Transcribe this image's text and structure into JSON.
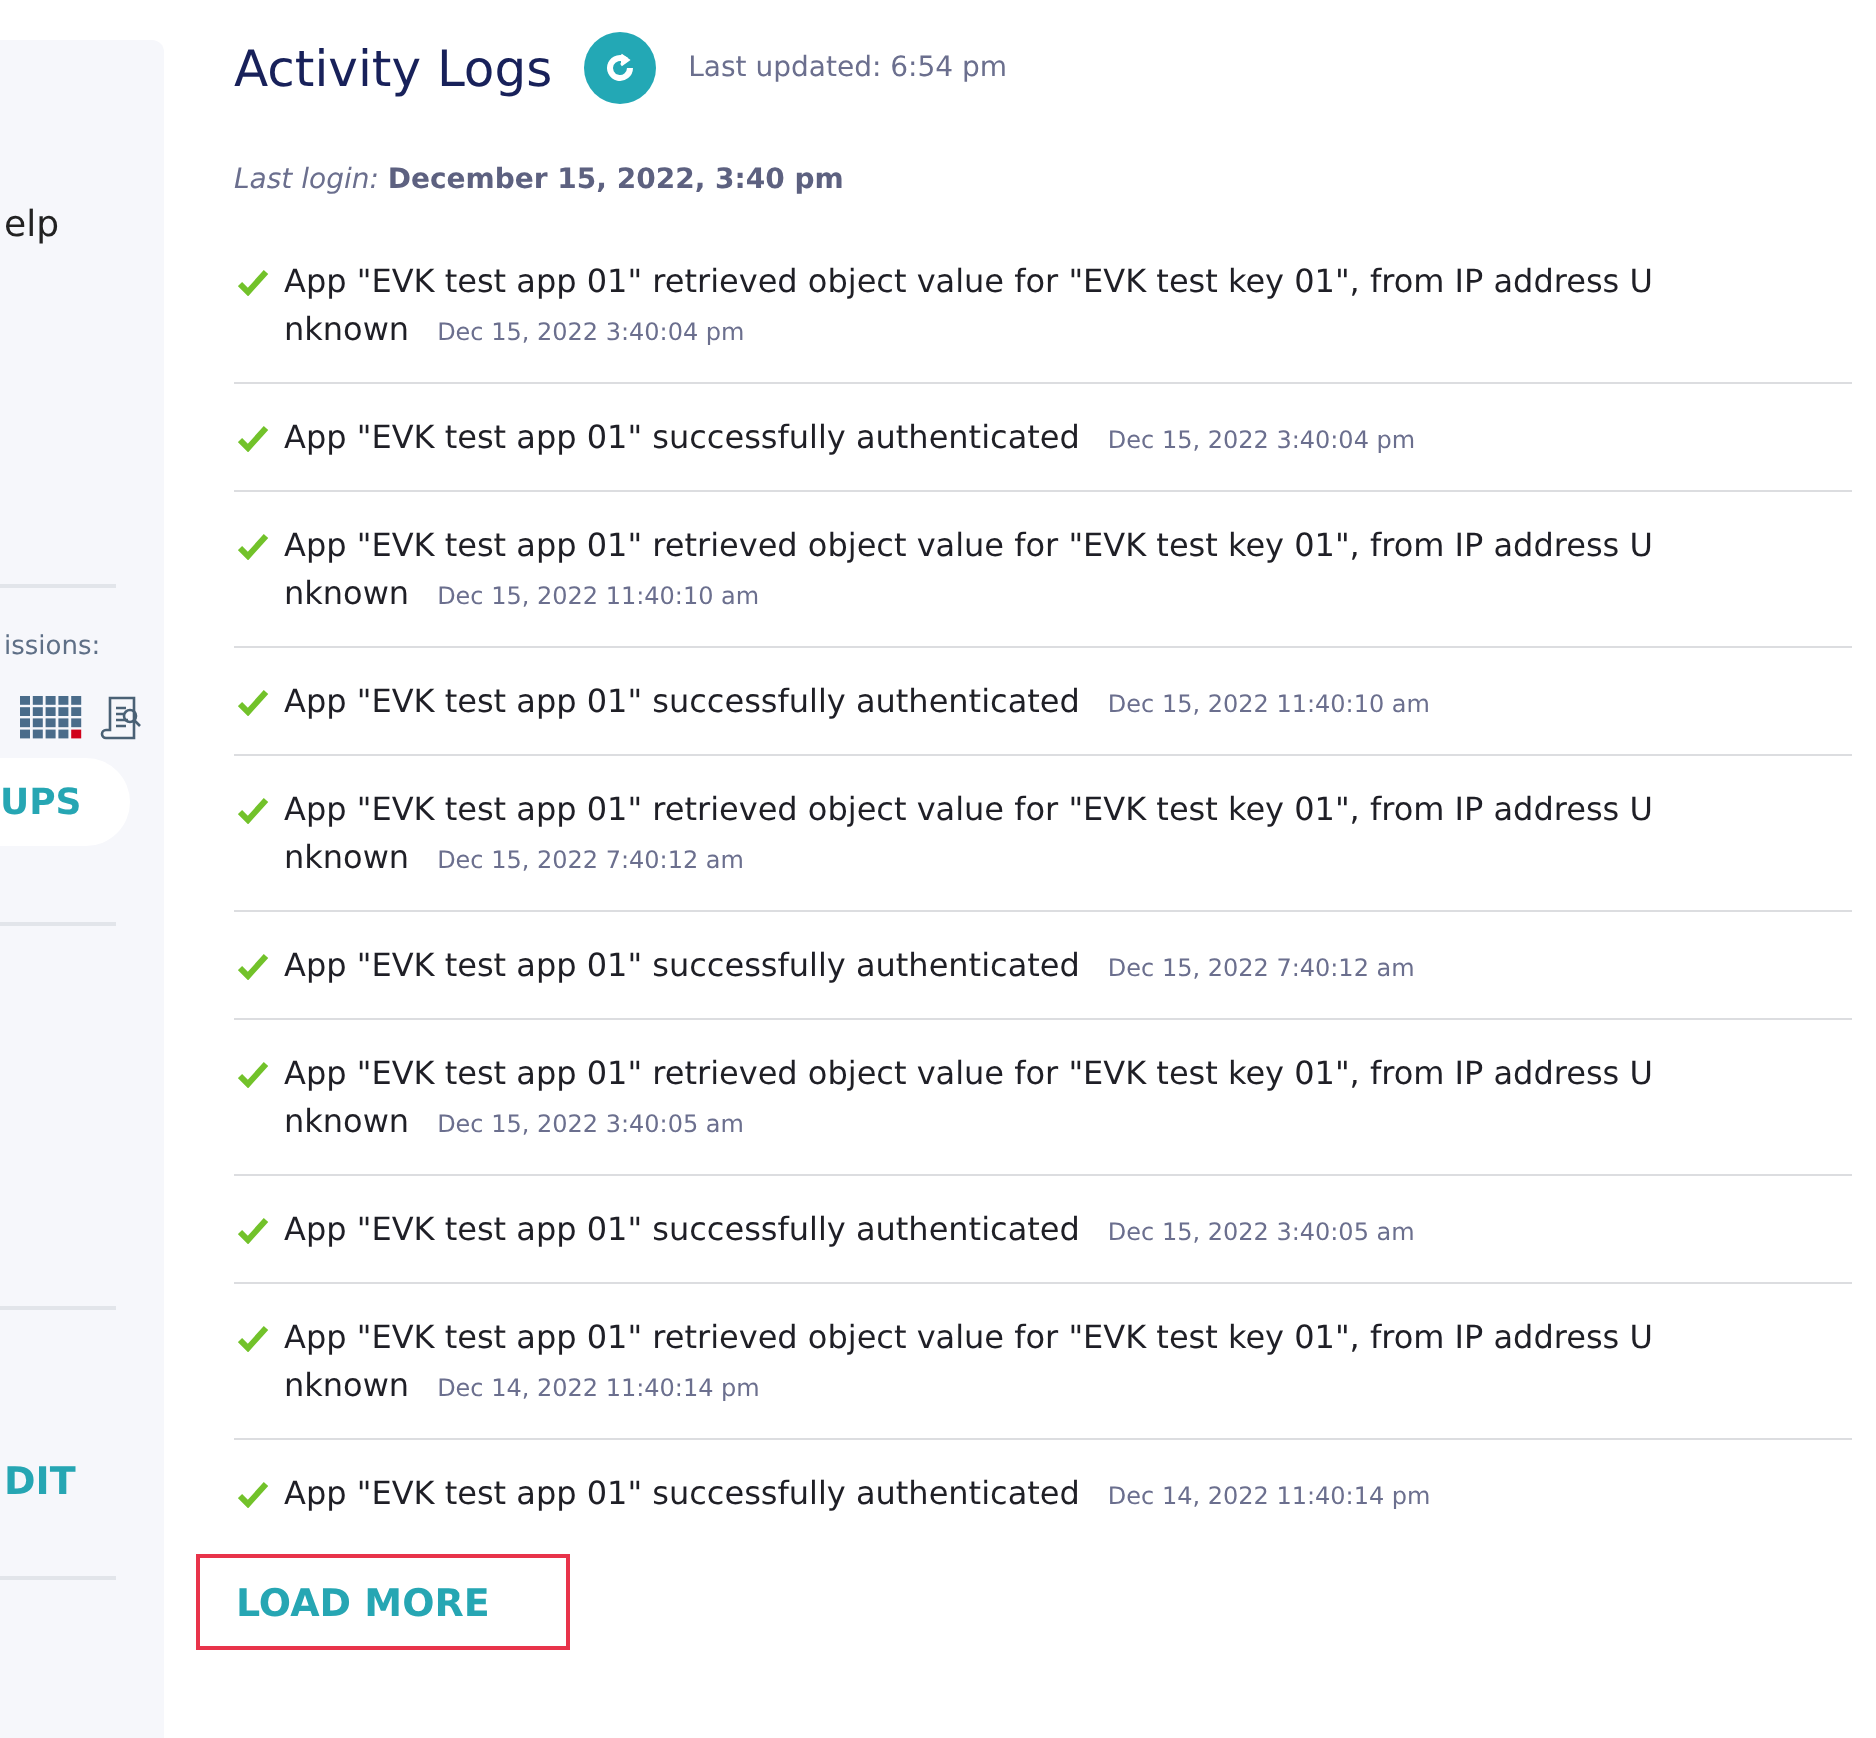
{
  "sidebar": {
    "texts": [
      {
        "kind": "text",
        "text": "elp"
      },
      {
        "kind": "divider"
      },
      {
        "kind": "caption",
        "text": "issions:"
      },
      {
        "kind": "icons"
      },
      {
        "kind": "pill",
        "text": "UPS"
      },
      {
        "kind": "divider"
      },
      {
        "kind": "space"
      },
      {
        "kind": "divider"
      },
      {
        "kind": "link",
        "text": "DIT"
      },
      {
        "kind": "divider"
      }
    ]
  },
  "header": {
    "title": "Activity Logs",
    "updated": "Last updated: 6:54 pm"
  },
  "last_login": {
    "label": "Last login:",
    "value": "December 15, 2022, 3:40 pm"
  },
  "logs": [
    {
      "message": "App \"EVK test app 01\" retrieved object value for \"EVK test key 01\", from IP address Unknown",
      "time": "Dec 15, 2022 3:40:04 pm"
    },
    {
      "message": "App \"EVK test app 01\" successfully authenticated",
      "time": "Dec 15, 2022 3:40:04 pm"
    },
    {
      "message": "App \"EVK test app 01\" retrieved object value for \"EVK test key 01\", from IP address Unknown",
      "time": "Dec 15, 2022 11:40:10 am"
    },
    {
      "message": "App \"EVK test app 01\" successfully authenticated",
      "time": "Dec 15, 2022 11:40:10 am"
    },
    {
      "message": "App \"EVK test app 01\" retrieved object value for \"EVK test key 01\", from IP address Unknown",
      "time": "Dec 15, 2022 7:40:12 am"
    },
    {
      "message": "App \"EVK test app 01\" successfully authenticated",
      "time": "Dec 15, 2022 7:40:12 am"
    },
    {
      "message": "App \"EVK test app 01\" retrieved object value for \"EVK test key 01\", from IP address Unknown",
      "time": "Dec 15, 2022 3:40:05 am"
    },
    {
      "message": "App \"EVK test app 01\" successfully authenticated",
      "time": "Dec 15, 2022 3:40:05 am"
    },
    {
      "message": "App \"EVK test app 01\" retrieved object value for \"EVK test key 01\", from IP address Unknown",
      "time": "Dec 14, 2022 11:40:14 pm"
    },
    {
      "message": "App \"EVK test app 01\" successfully authenticated",
      "time": "Dec 14, 2022 11:40:14 pm"
    }
  ],
  "load_more": {
    "label": "LOAD MORE",
    "highlighted": true
  }
}
